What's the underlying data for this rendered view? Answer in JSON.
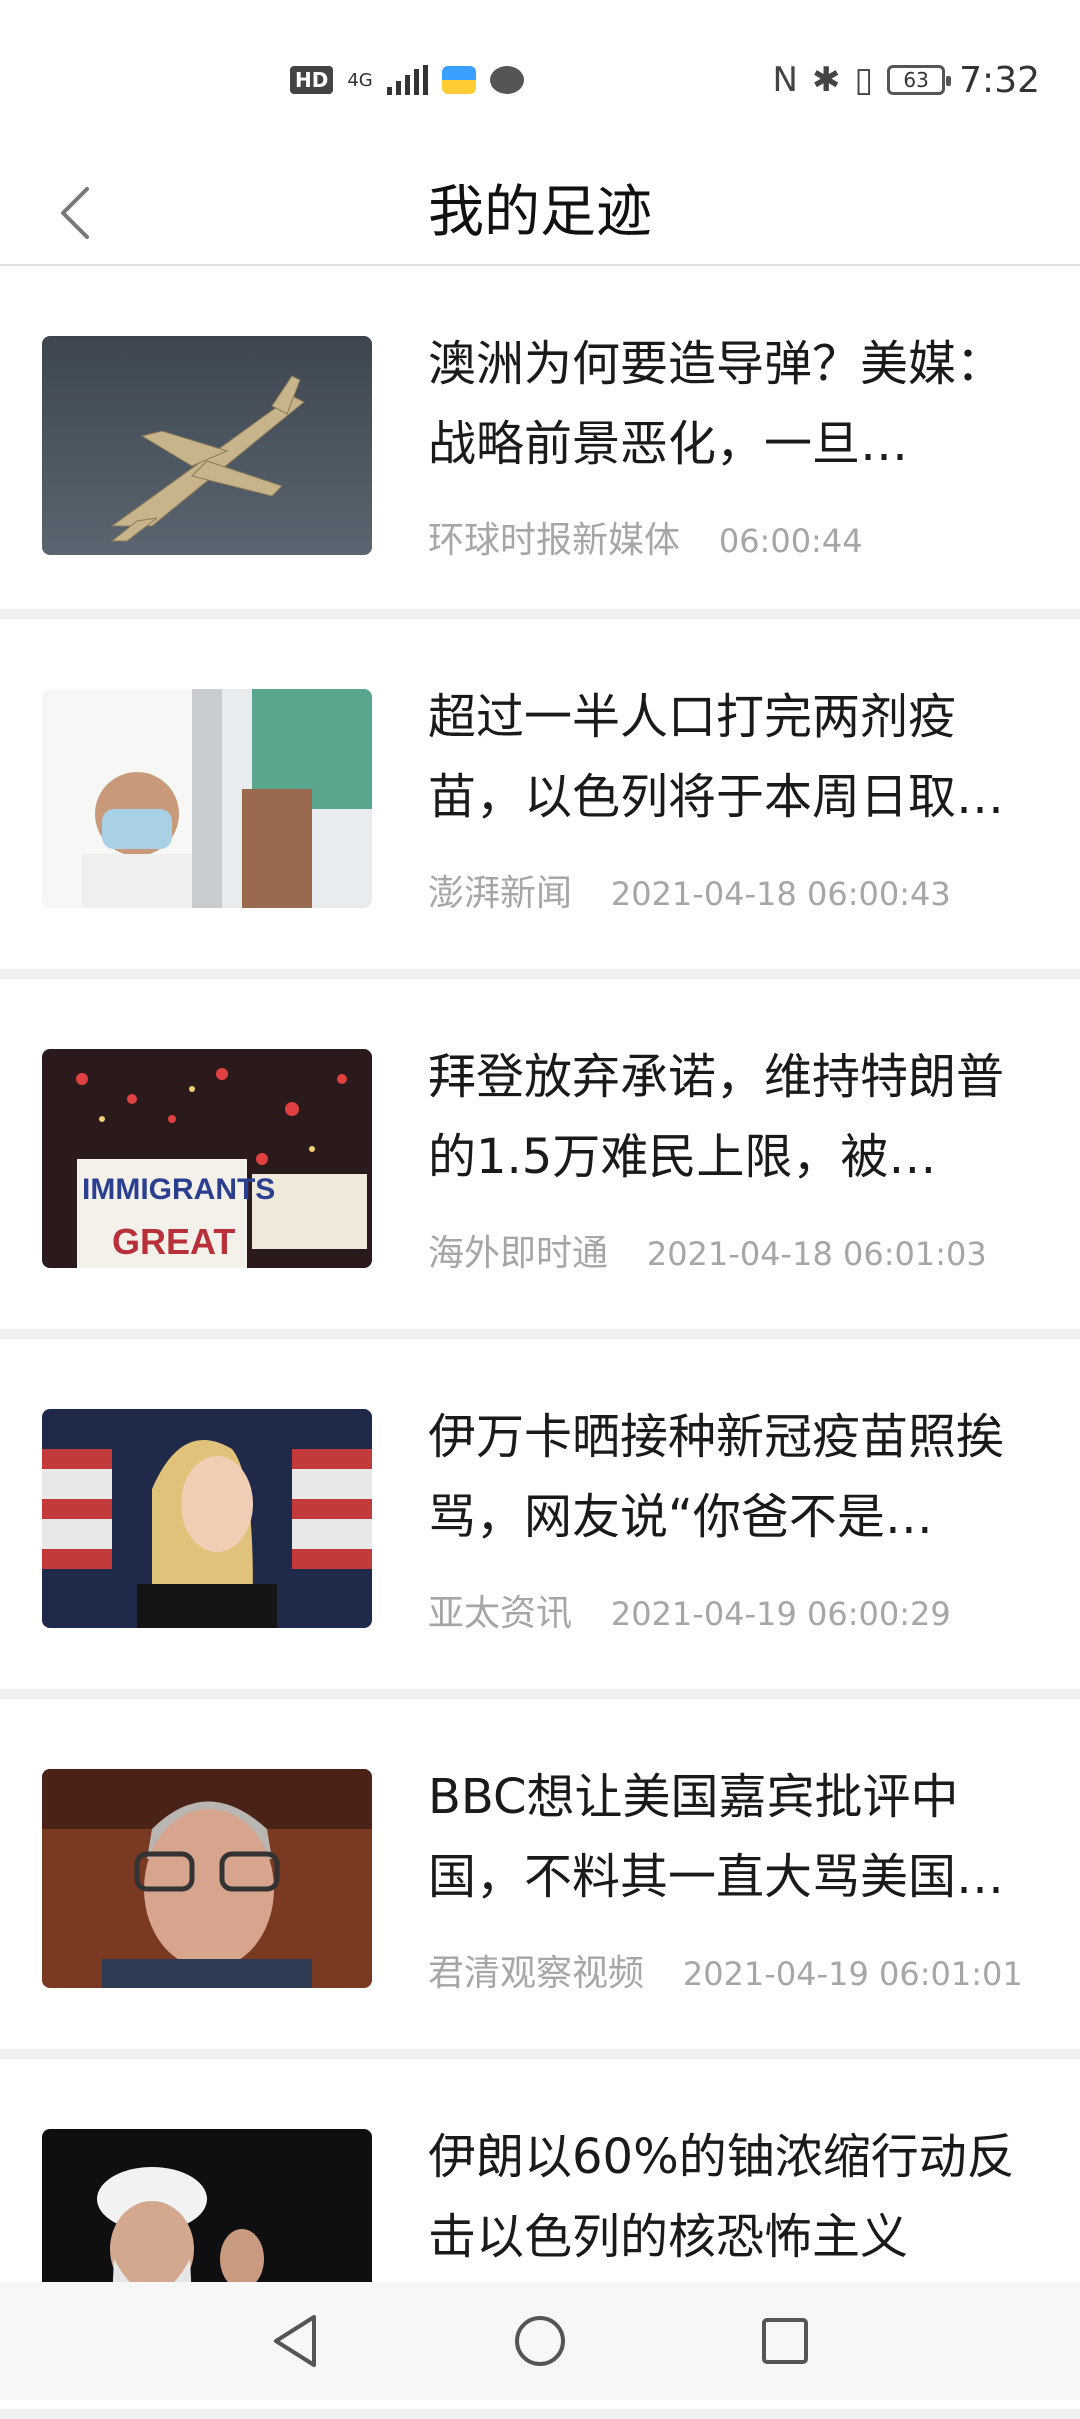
{
  "status_bar": {
    "left_badge": "HD",
    "network": "4G",
    "time": "7:32",
    "battery": "63",
    "nfc": "N",
    "bluetooth": "✱",
    "vibrate": "▯"
  },
  "header": {
    "title": "我的足迹"
  },
  "news": [
    {
      "title": "澳洲为何要造导弹？美媒：战略前景恶化，一旦…",
      "source": "环球时报新媒体",
      "time": "06:00:44"
    },
    {
      "title": "超过一半人口打完两剂疫苗，以色列将于本周日取…",
      "source": "澎湃新闻",
      "time": "2021-04-18 06:00:43"
    },
    {
      "title": "拜登放弃承诺，维持特朗普的1.5万难民上限，被…",
      "source": "海外即时通",
      "time": "2021-04-18 06:01:03"
    },
    {
      "title": "伊万卡晒接种新冠疫苗照挨骂，网友说“你爸不是…",
      "source": "亚太资讯",
      "time": "2021-04-19 06:00:29"
    },
    {
      "title": "BBC想让美国嘉宾批评中国，不料其一直大骂美国…",
      "source": "君清观察视频",
      "time": "2021-04-19 06:01:01"
    },
    {
      "title": "伊朗以60%的铀浓缩行动反击以色列的核恐怖主义",
      "source": "",
      "time": ""
    }
  ],
  "colors": {
    "meta_text": "#a6a6a6",
    "divider": "#f1f1f1",
    "nav_bg": "#f7f7f7"
  }
}
